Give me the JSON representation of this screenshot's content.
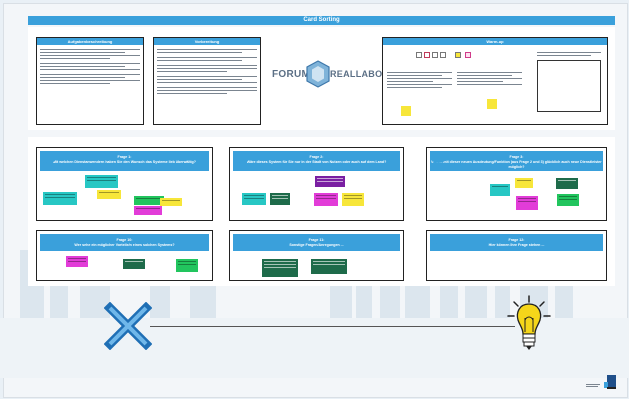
{
  "banner": {
    "title": "Card Sorting"
  },
  "instructions": {
    "card1_title": "Aufgabenbeschreibung",
    "card2_title": "Vorbereitung",
    "card3_title": "Warm-up",
    "logo_word1": "FORUM",
    "logo_word2": "REALLABOR"
  },
  "questions": [
    {
      "label": "Frage 1:",
      "text": "Mit welchen Dienstanwendern haben Sie den Wunsch das Systeme lieb überwältig?"
    },
    {
      "label": "Frage 2:",
      "text": "Wäre dieses System für Sie nur in der Stadt von Nutzen oder auch auf dem Land?"
    },
    {
      "label": "Frage 3:",
      "text": "Wären mit dieser neuen Ausdeutung/Funktion (aus Frage 2 und 3) glücklich auch neue Dienstleister möglich?"
    },
    {
      "label": "Frage 10:",
      "text": "Wer sehe ein möglicher Vorteile/n eines solchen Systems?"
    },
    {
      "label": "Frage 11:",
      "text": "Sonstige Fragen/Anregungen ..."
    },
    {
      "label": "Frage 12:",
      "text": "Hier können Ihre Frage stehen ..."
    }
  ],
  "colors": {
    "accent": "#3aa0db",
    "cross": "#1f6fb5",
    "bulb": "#f5d61a",
    "sticky_cyan": "#27c7c4",
    "sticky_purple": "#7a1fa2",
    "sticky_magenta": "#e23cd8",
    "sticky_yellow": "#f7e63a",
    "sticky_green": "#22c55e",
    "sticky_darkgreen": "#1e6b4a"
  },
  "icons": [
    "x-cross-icon",
    "light-bulb-icon",
    "speech-bubble-icon",
    "presenter-icon"
  ]
}
